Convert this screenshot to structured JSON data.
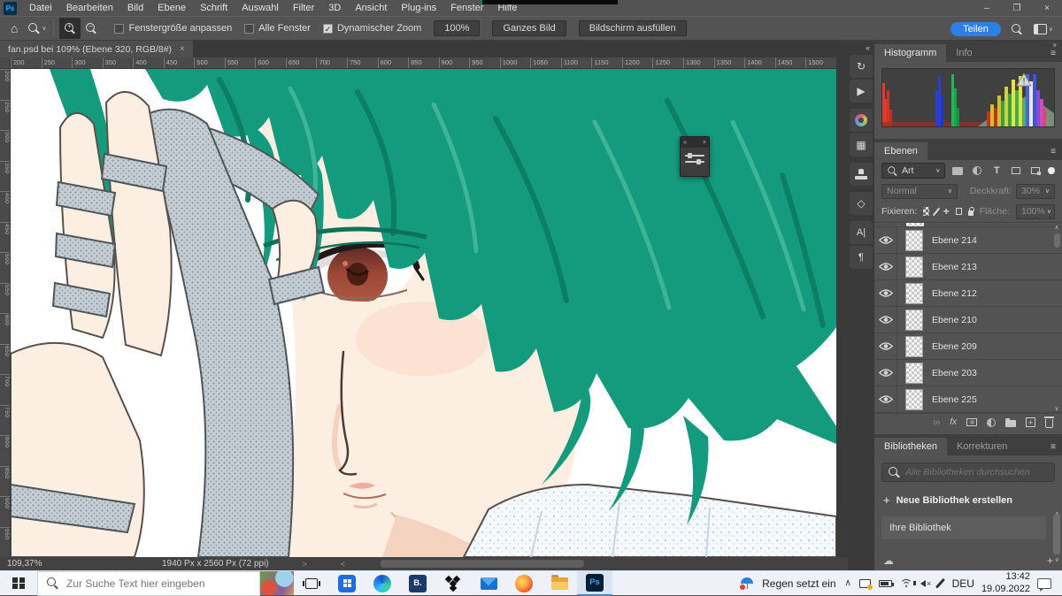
{
  "app": {
    "logo": "Ps"
  },
  "menu": {
    "items": [
      "Datei",
      "Bearbeiten",
      "Bild",
      "Ebene",
      "Schrift",
      "Auswahl",
      "Filter",
      "3D",
      "Ansicht",
      "Plug-ins",
      "Fenster",
      "Hilfe"
    ]
  },
  "options": {
    "fit_window": "Fenstergröße anpassen",
    "all_windows": "Alle Fenster",
    "dynamic_zoom": "Dynamischer Zoom",
    "zoom_value": "100%",
    "fit_screen": "Ganzes Bild",
    "fill_screen": "Bildschirm ausfüllen",
    "share": "Teilen"
  },
  "document": {
    "tab_title": "fan.psd bei 109% (Ebene 320, RGB/8#)"
  },
  "rulers": {
    "top": [
      "200",
      "250",
      "300",
      "350",
      "400",
      "450",
      "500",
      "550",
      "600",
      "650",
      "700",
      "750",
      "800",
      "850",
      "900",
      "950",
      "1000",
      "1050",
      "1100",
      "1150",
      "1200",
      "1250",
      "1300",
      "1350",
      "1400",
      "1450",
      "1500"
    ],
    "left": [
      "200",
      "250",
      "300",
      "350",
      "400",
      "450",
      "500",
      "550",
      "600",
      "650",
      "700",
      "750",
      "800",
      "850",
      "900",
      "950"
    ]
  },
  "status": {
    "zoom_level": "109,37%",
    "doc_size": "1940 Px x 2560 Px (72 ppi)"
  },
  "panels": {
    "histogram": {
      "tab_active": "Histogramm",
      "tab_info": "Info"
    },
    "layers": {
      "tab": "Ebenen",
      "filter_value": "Art",
      "blend_mode": "Normal",
      "opacity_label": "Deckkraft:",
      "opacity_value": "30%",
      "lock_label": "Fixieren:",
      "fill_label": "Fläche:",
      "fill_value": "100%",
      "fx_label": "fx",
      "items": [
        "Ebene 214",
        "Ebene 213",
        "Ebene 212",
        "Ebene 210",
        "Ebene 209",
        "Ebene 203",
        "Ebene 225"
      ]
    },
    "libraries": {
      "tab_active": "Bibliotheken",
      "tab_adjustments": "Korrekturen",
      "search_placeholder": "Alle Bibliotheken durchsuchen",
      "create_label": "Neue Bibliothek erstellen",
      "item_label": "Ihre Bibliothek"
    }
  },
  "taskbar": {
    "search_placeholder": "Zur Suche Text hier eingeben",
    "app_b_label": "B.",
    "app_ps_label": "Ps",
    "weather_text": "Regen setzt ein",
    "language": "DEU",
    "time": "13:42",
    "date": "19.09.2022"
  },
  "icons": {
    "minimize": "–",
    "maximize": "❐",
    "close": "×",
    "tab_close": "×",
    "menu": "≡",
    "collapse": "«",
    "expand": "»",
    "chevron_down": "∨",
    "chevron_up": "∧",
    "check": "✓",
    "plus": "+",
    "cloud": "☁",
    "play": "▶",
    "history": "↻",
    "swatches": "▦",
    "cube": "◇",
    "character": "A|",
    "paragraph": "¶",
    "link": "∞",
    "home": "⌂",
    "text_tool": "T",
    "arrow_right": ">",
    "arrow_left": "<"
  },
  "colors": {
    "accent_blue": "#2e7fe8",
    "hair_green": "#149a7c",
    "ps_blue": "#31a8ff"
  }
}
